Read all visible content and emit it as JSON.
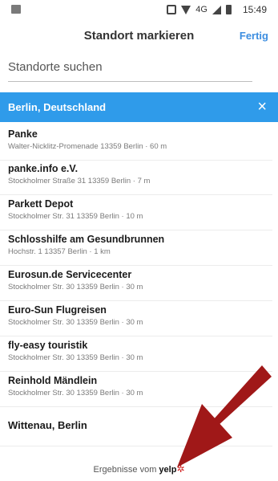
{
  "status_bar": {
    "network": "4G",
    "time": "15:49",
    "icons": [
      "image-icon",
      "vibrate-icon",
      "wifi-icon",
      "signal-icon",
      "battery-icon"
    ]
  },
  "header": {
    "title": "Standort markieren",
    "done_label": "Fertig"
  },
  "search": {
    "placeholder": "Standorte suchen"
  },
  "city": {
    "label": "Berlin, Deutschland",
    "clear_icon": "×"
  },
  "places": [
    {
      "name": "Panke",
      "address": "Walter-Nicklitz-Promenade 13359 Berlin · 60 m"
    },
    {
      "name": "panke.info e.V.",
      "address": "Stockholmer Straße 31 13359 Berlin · 7 m"
    },
    {
      "name": "Parkett Depot",
      "address": "Stockholmer Str. 31 13359 Berlin · 10 m"
    },
    {
      "name": "Schlosshilfe am Gesundbrunnen",
      "address": "Hochstr. 1 13357 Berlin · 1 km"
    },
    {
      "name": "Eurosun.de Servicecenter",
      "address": "Stockholmer Str. 30 13359 Berlin · 30 m"
    },
    {
      "name": "Euro-Sun Flugreisen",
      "address": "Stockholmer Str. 30 13359 Berlin · 30 m"
    },
    {
      "name": "fly-easy touristik",
      "address": "Stockholmer Str. 30 13359 Berlin · 30 m"
    },
    {
      "name": "Reinhold Mändlein",
      "address": "Stockholmer Str. 30 13359 Berlin · 30 m"
    },
    {
      "name": "Wittenau, Berlin",
      "address": ""
    }
  ],
  "footer": {
    "prefix": "Ergebnisse vom",
    "brand": "yelp",
    "brand_mark": "✲"
  },
  "colors": {
    "accent": "#2f9bea",
    "link": "#3d8ee0",
    "annotation": "#a01818"
  }
}
